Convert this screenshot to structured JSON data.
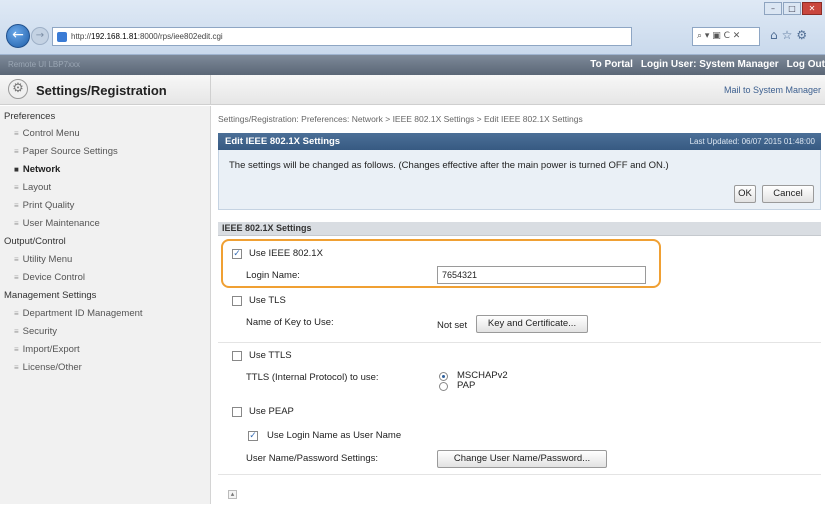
{
  "browser": {
    "url_prefix": "http://",
    "url_host": "192.168.1.81",
    "url_path": ":8000/rps/iee802edit.cgi",
    "search_text": "⌕ ▾ ▣ C ✕",
    "window_min": "–",
    "window_max": "□",
    "window_close": "✕"
  },
  "topbar": {
    "brand": "Remote UI    LBP7xxx",
    "to_portal": "To Portal",
    "login_user": "Login User: System Manager",
    "logout": "Log Out"
  },
  "title": {
    "text": "Settings/Registration",
    "mail": "Mail to System Manager"
  },
  "sidebar": {
    "groups": [
      {
        "label": "Preferences",
        "items": [
          "Control Menu",
          "Paper Source Settings",
          "Network",
          "Layout",
          "Print Quality",
          "User Maintenance"
        ]
      },
      {
        "label": "Output/Control",
        "items": [
          "Utility Menu",
          "Device Control"
        ]
      },
      {
        "label": "Management Settings",
        "items": [
          "Department ID Management",
          "Security",
          "Import/Export",
          "License/Other"
        ]
      }
    ],
    "active_item": "Network"
  },
  "breadcrumb": "Settings/Registration: Preferences: Network > IEEE 802.1X Settings > Edit IEEE 802.1X Settings",
  "panel": {
    "title": "Edit IEEE 802.1X Settings",
    "last_updated": "Last Updated: 06/07 2015 01:48:00",
    "message": "The settings will be changed as follows. (Changes effective after the main power is turned OFF and ON.)",
    "ok": "OK",
    "cancel": "Cancel"
  },
  "section": {
    "title": "IEEE 802.1X Settings",
    "use_ieee": {
      "label": "Use IEEE 802.1X",
      "checked": true
    },
    "login_name": {
      "label": "Login Name:",
      "value": "7654321"
    },
    "use_tls": {
      "label": "Use TLS",
      "checked": false
    },
    "key_to_use": {
      "label": "Name of Key to Use:",
      "value": "Not set",
      "button": "Key and Certificate..."
    },
    "use_ttls": {
      "label": "Use TTLS",
      "checked": false
    },
    "ttls_protocol": {
      "label": "TTLS (Internal Protocol) to use:",
      "options": [
        "MSCHAPv2",
        "PAP"
      ],
      "selected": "MSCHAPv2"
    },
    "use_peap": {
      "label": "Use PEAP",
      "checked": false
    },
    "use_login_as_user": {
      "label": "Use Login Name as User Name",
      "checked": true
    },
    "user_pw_settings": {
      "label": "User Name/Password Settings:",
      "button": "Change User Name/Password..."
    }
  },
  "scroll_top": "▴",
  "colors": {
    "panel_header": "#3f638c",
    "highlight": "#f0a033"
  },
  "icons": {
    "settings": "gear-icon",
    "back": "back-arrow-icon",
    "forward": "forward-arrow-icon"
  }
}
